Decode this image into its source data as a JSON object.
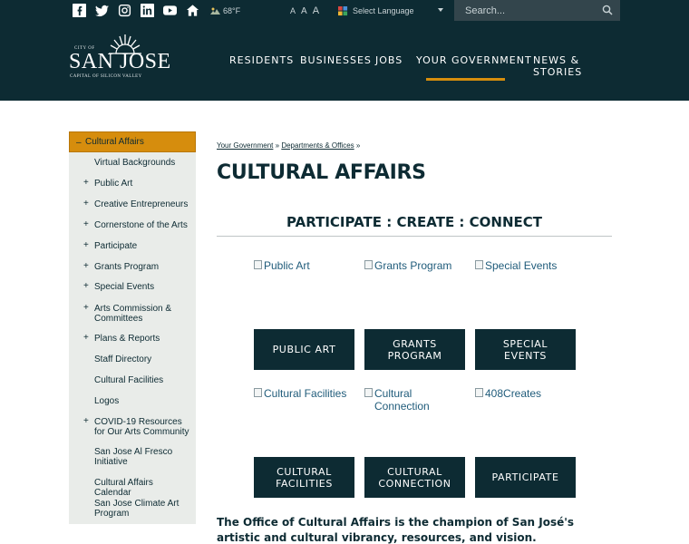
{
  "header": {
    "social_icons": [
      "facebook-icon",
      "twitter-icon",
      "instagram-icon",
      "linkedin-icon",
      "youtube-icon",
      "home-icon"
    ],
    "weather": {
      "icon": "weather-icon",
      "temp": "68°F"
    },
    "font_sizes": [
      "A",
      "A",
      "A"
    ],
    "language": {
      "label": "Select Language",
      "icon": "globe-icon"
    },
    "search": {
      "placeholder": "Search..."
    },
    "logo": {
      "city_of": "CITY OF",
      "name": "SAN JOSE",
      "tagline": "CAPITAL OF SILICON VALLEY"
    },
    "nav": [
      {
        "label": "RESIDENTS",
        "active": false
      },
      {
        "label": "BUSINESSES",
        "active": false
      },
      {
        "label": "JOBS",
        "active": false
      },
      {
        "label": "YOUR GOVERNMENT",
        "active": true
      },
      {
        "label": "NEWS & STORIES",
        "active": false
      }
    ],
    "colors": {
      "header_bg": "#0d2b33",
      "accent": "#d68d0d"
    }
  },
  "sidebar": {
    "title": "Cultural Affairs",
    "items": [
      {
        "label": "Virtual Backgrounds",
        "expandable": false
      },
      {
        "label": "Public Art",
        "expandable": true
      },
      {
        "label": "Creative Entrepreneurs",
        "expandable": true
      },
      {
        "label": "Cornerstone of the Arts",
        "expandable": true
      },
      {
        "label": "Participate",
        "expandable": true
      },
      {
        "label": "Grants Program",
        "expandable": true
      },
      {
        "label": "Special Events",
        "expandable": true
      },
      {
        "label": "Arts Commission & Committees",
        "expandable": true
      },
      {
        "label": "Plans & Reports",
        "expandable": true
      },
      {
        "label": "Staff Directory",
        "expandable": false
      },
      {
        "label": "Cultural Facilities",
        "expandable": false
      },
      {
        "label": "Logos",
        "expandable": false
      },
      {
        "label": "COVID-19 Resources for Our Arts Community",
        "expandable": true
      },
      {
        "label": "San Jose Al Fresco Initiative",
        "expandable": false
      },
      {
        "label": "Cultural Affairs Calendar",
        "expandable": false
      },
      {
        "label": "San Jose Climate Art Program",
        "expandable": false
      }
    ]
  },
  "breadcrumb": [
    {
      "label": "Your Government"
    },
    {
      "label": "Departments & Offices"
    }
  ],
  "page_title": "CULTURAL AFFAIRS",
  "subtitle": "PARTICIPATE : CREATE : CONNECT",
  "tiles": [
    {
      "image_alt": "Public Art",
      "label": "PUBLIC ART"
    },
    {
      "image_alt": "Grants Program",
      "label": "GRANTS PROGRAM"
    },
    {
      "image_alt": "Special Events",
      "label": "SPECIAL EVENTS"
    },
    {
      "image_alt": "Cultural Facilities",
      "label": "CULTURAL FACILITIES"
    },
    {
      "image_alt": "Cultural Connection",
      "label": "CULTURAL CONNECTION"
    },
    {
      "image_alt": "408Creates",
      "label": "PARTICIPATE"
    }
  ],
  "intro": "The Office of Cultural Affairs is the champion of San José's artistic and cultural vibrancy, resources, and vision."
}
